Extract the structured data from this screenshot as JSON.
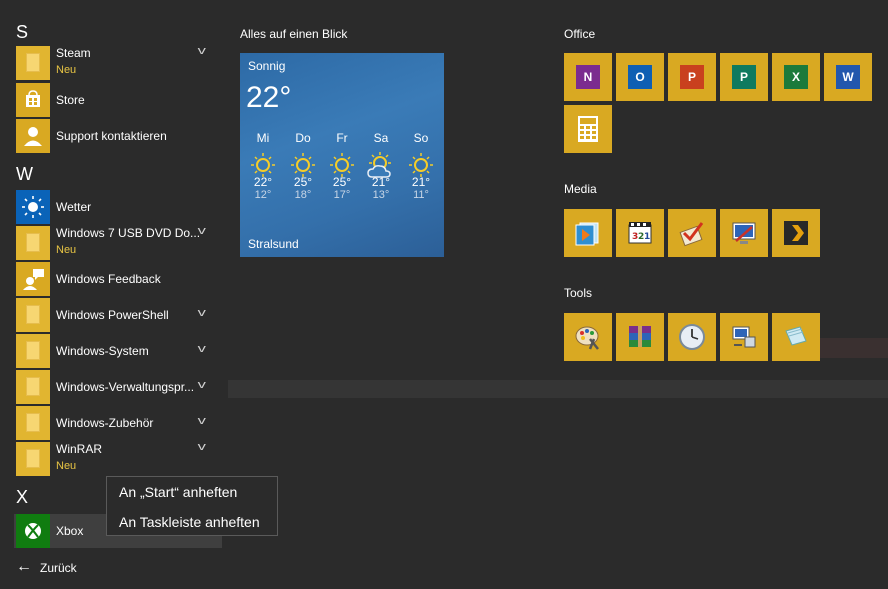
{
  "left_list": {
    "sections": [
      {
        "letter": "S"
      },
      {
        "letter": "W"
      },
      {
        "letter": "X"
      }
    ],
    "apps": [
      {
        "name": "Steam",
        "sub": "Neu"
      },
      {
        "name": "Store"
      },
      {
        "name": "Support kontaktieren"
      },
      {
        "name": "Wetter"
      },
      {
        "name": "Windows 7 USB DVD Do...",
        "sub": "Neu"
      },
      {
        "name": "Windows Feedback"
      },
      {
        "name": "Windows PowerShell"
      },
      {
        "name": "Windows-System"
      },
      {
        "name": "Windows-Verwaltungspr..."
      },
      {
        "name": "Windows-Zubehör"
      },
      {
        "name": "WinRAR",
        "sub": "Neu"
      },
      {
        "name": "Xbox"
      }
    ],
    "back_label": "Zurück"
  },
  "context_menu": {
    "items": [
      "An „Start“ anheften",
      "An Taskleiste anheften"
    ]
  },
  "groups": {
    "glance": {
      "title": "Alles auf einen Blick"
    },
    "office": {
      "title": "Office"
    },
    "media": {
      "title": "Media"
    },
    "tools": {
      "title": "Tools"
    }
  },
  "weather": {
    "condition": "Sonnig",
    "temperature": "22°",
    "city": "Stralsund",
    "days": [
      {
        "day": "Mi",
        "high": "22°",
        "low": "12°",
        "icon": "sun-icon"
      },
      {
        "day": "Do",
        "high": "25°",
        "low": "18°",
        "icon": "sun-icon"
      },
      {
        "day": "Fr",
        "high": "25°",
        "low": "17°",
        "icon": "sun-icon"
      },
      {
        "day": "Sa",
        "high": "21°",
        "low": "13°",
        "icon": "partly-cloudy-icon"
      },
      {
        "day": "So",
        "high": "21°",
        "low": "11°",
        "icon": "sun-icon"
      }
    ]
  },
  "office_tiles": [
    {
      "icon": "onenote-icon",
      "letter": "N",
      "color": "#7b2c8f"
    },
    {
      "icon": "outlook-icon",
      "letter": "O",
      "color": "#0f5fb3"
    },
    {
      "icon": "powerpoint-icon",
      "letter": "P",
      "color": "#c9401e"
    },
    {
      "icon": "publisher-icon",
      "letter": "P",
      "color": "#0f7a5f"
    },
    {
      "icon": "excel-icon",
      "letter": "X",
      "color": "#1c7a3b"
    },
    {
      "icon": "word-icon",
      "letter": "W",
      "color": "#2257ad"
    },
    {
      "icon": "calculator-icon"
    }
  ],
  "media_tiles": [
    {
      "icon": "media-player-icon"
    },
    {
      "icon": "video-editor-icon"
    },
    {
      "icon": "checklist-icon"
    },
    {
      "icon": "screen-capture-icon"
    },
    {
      "icon": "plex-icon"
    }
  ],
  "tools_tiles": [
    {
      "icon": "paint-icon"
    },
    {
      "icon": "winrar-icon"
    },
    {
      "icon": "clock-icon"
    },
    {
      "icon": "network-icon"
    },
    {
      "icon": "notes-icon"
    }
  ],
  "colors": {
    "tile": "#d9a922",
    "accent_text": "#e8c544",
    "background": "#2b2b2b",
    "weather_tile": "#3a7bb7"
  }
}
